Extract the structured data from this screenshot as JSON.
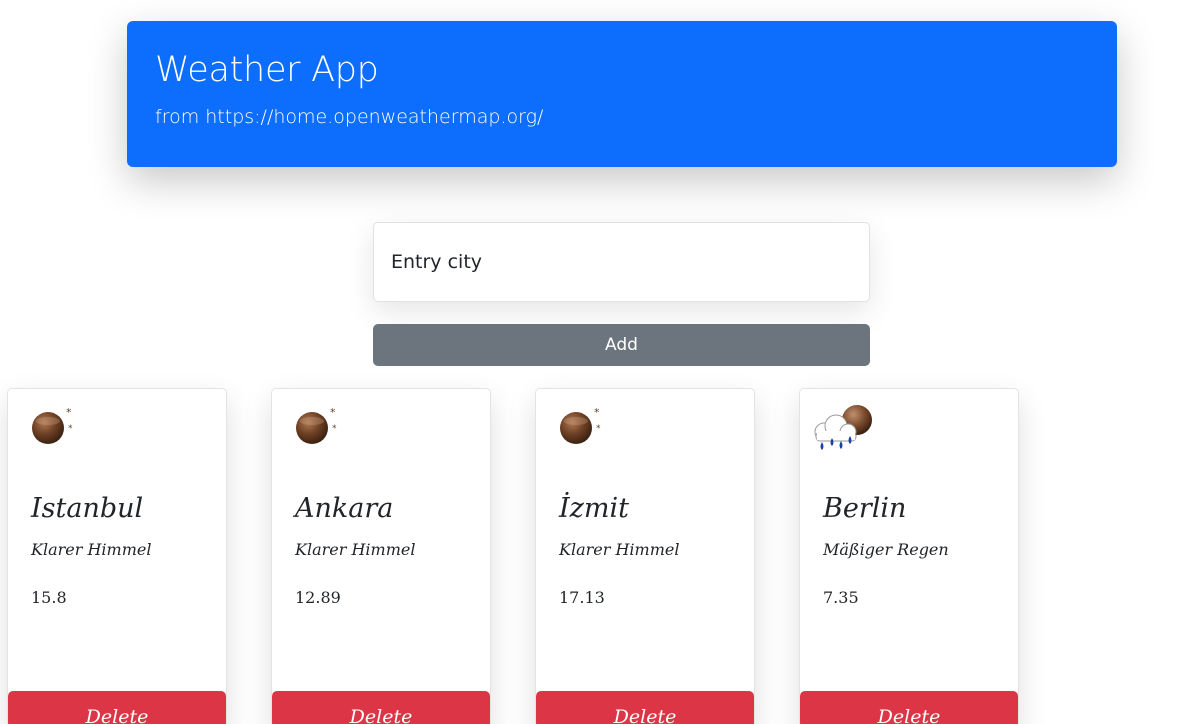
{
  "header": {
    "title": "Weather App",
    "subtitle": "from https://home.openweathermap.org/"
  },
  "search": {
    "placeholder": "Entry city",
    "add_label": "Add"
  },
  "cards": [
    {
      "city": "Istanbul",
      "description": "Klarer Himmel",
      "temp": "15.8",
      "icon": "clear-night-icon",
      "delete_label": "Delete"
    },
    {
      "city": "Ankara",
      "description": "Klarer Himmel",
      "temp": "12.89",
      "icon": "clear-night-icon",
      "delete_label": "Delete"
    },
    {
      "city": "İzmit",
      "description": "Klarer Himmel",
      "temp": "17.13",
      "icon": "clear-night-icon",
      "delete_label": "Delete"
    },
    {
      "city": "Berlin",
      "description": "Mäßiger Regen",
      "temp": "7.35",
      "icon": "rain-night-icon",
      "delete_label": "Delete"
    }
  ],
  "colors": {
    "primary": "#0d6efd",
    "secondary": "#6c757d",
    "danger": "#dc3545"
  }
}
